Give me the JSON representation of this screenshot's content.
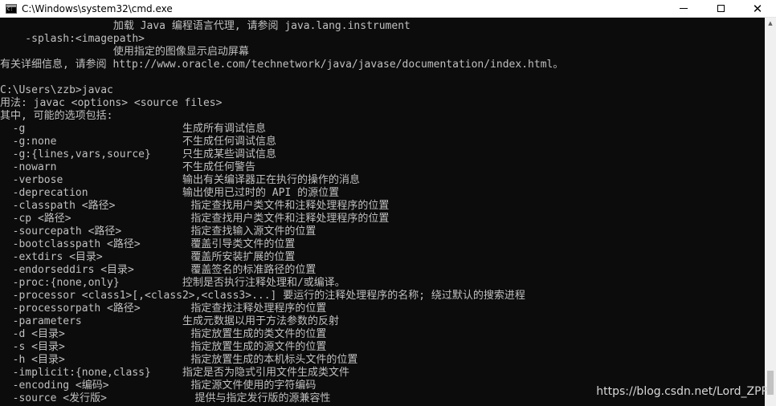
{
  "window": {
    "title": "C:\\Windows\\system32\\cmd.exe",
    "minimize_glyph": "",
    "close_glyph": "✕"
  },
  "console": {
    "lines": [
      "                  加载 Java 编程语言代理, 请参阅 java.lang.instrument",
      "    -splash:<imagepath>",
      "                  使用指定的图像显示启动屏幕",
      "有关详细信息, 请参阅 http://www.oracle.com/technetwork/java/javase/documentation/index.html。",
      "",
      "C:\\Users\\zzb>javac",
      "用法: javac <options> <source files>",
      "其中, 可能的选项包括:",
      "  -g                         生成所有调试信息",
      "  -g:none                    不生成任何调试信息",
      "  -g:{lines,vars,source}     只生成某些调试信息",
      "  -nowarn                    不生成任何警告",
      "  -verbose                   输出有关编译器正在执行的操作的消息",
      "  -deprecation               输出使用已过时的 API 的源位置",
      "  -classpath <路径>            指定查找用户类文件和注释处理程序的位置",
      "  -cp <路径>                   指定查找用户类文件和注释处理程序的位置",
      "  -sourcepath <路径>           指定查找输入源文件的位置",
      "  -bootclasspath <路径>        覆盖引导类文件的位置",
      "  -extdirs <目录>              覆盖所安装扩展的位置",
      "  -endorseddirs <目录>         覆盖签名的标准路径的位置",
      "  -proc:{none,only}          控制是否执行注释处理和/或编译。",
      "  -processor <class1>[,<class2>,<class3>...] 要运行的注释处理程序的名称; 绕过默认的搜索进程",
      "  -processorpath <路径>        指定查找注释处理程序的位置",
      "  -parameters                生成元数据以用于方法参数的反射",
      "  -d <目录>                    指定放置生成的类文件的位置",
      "  -s <目录>                    指定放置生成的源文件的位置",
      "  -h <目录>                    指定放置生成的本机标头文件的位置",
      "  -implicit:{none,class}     指定是否为隐式引用文件生成类文件",
      "  -encoding <编码>             指定源文件使用的字符编码",
      "  -source <发行版>              提供与指定发行版的源兼容性"
    ]
  },
  "scrollbar": {
    "up_arrow": "▲"
  },
  "watermark": "https://blog.csdn.net/Lord_ZPP",
  "colors": {
    "console_background": "#0c0c0c",
    "console_text": "#c0c0c0",
    "titlebar_background": "#ffffff"
  }
}
